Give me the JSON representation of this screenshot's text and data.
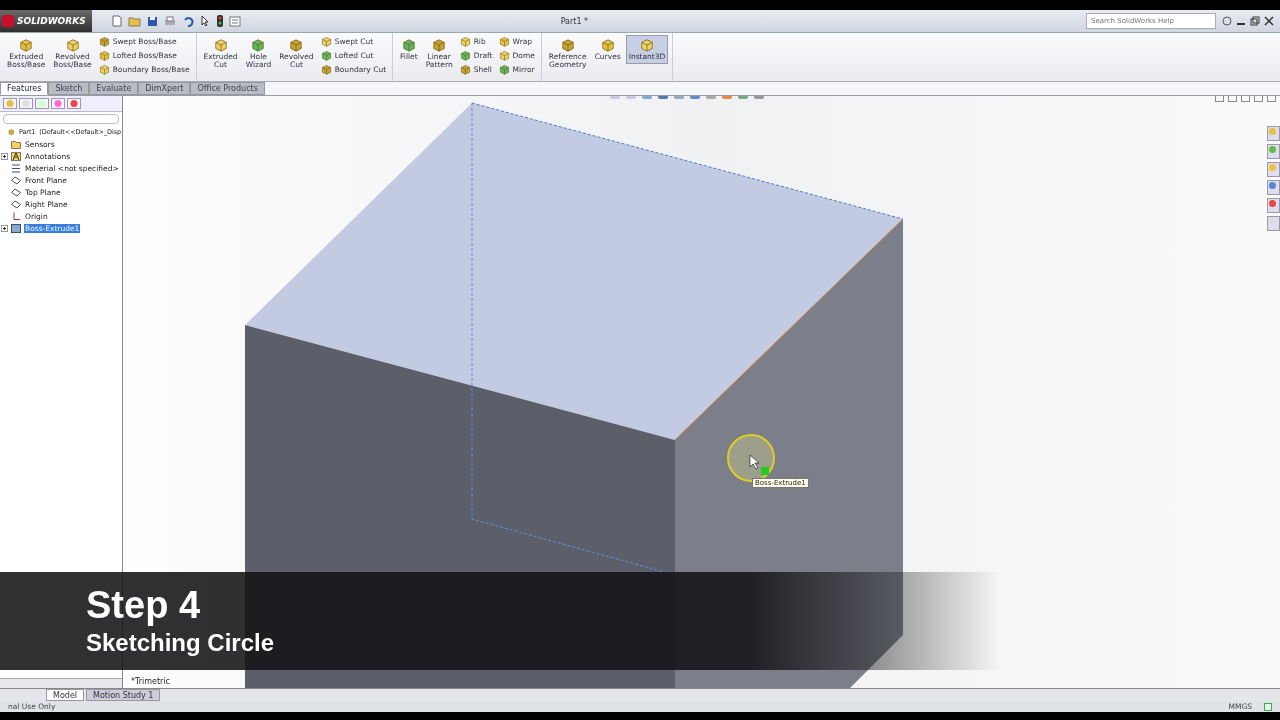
{
  "app": {
    "logo": "SOLIDWORKS",
    "document_title": "Part1 *",
    "search": {
      "placeholder": "Search SolidWorks Help"
    }
  },
  "ribbon": {
    "groups": [
      {
        "items": [
          {
            "label": "Extruded\nBoss/Base",
            "kind": "large"
          },
          {
            "label": "Revolved\nBoss/Base",
            "kind": "large"
          },
          {
            "label": "Swept Boss/Base",
            "kind": "small"
          },
          {
            "label": "Lofted Boss/Base",
            "kind": "small"
          },
          {
            "label": "Boundary Boss/Base",
            "kind": "small"
          }
        ]
      },
      {
        "items": [
          {
            "label": "Extruded\nCut",
            "kind": "large"
          },
          {
            "label": "Hole\nWizard",
            "kind": "large"
          },
          {
            "label": "Revolved\nCut",
            "kind": "large"
          },
          {
            "label": "Swept Cut",
            "kind": "small"
          },
          {
            "label": "Lofted Cut",
            "kind": "small"
          },
          {
            "label": "Boundary Cut",
            "kind": "small"
          }
        ]
      },
      {
        "items": [
          {
            "label": "Fillet",
            "kind": "large"
          },
          {
            "label": "Linear\nPattern",
            "kind": "large"
          },
          {
            "label": "Rib",
            "kind": "small"
          },
          {
            "label": "Draft",
            "kind": "small"
          },
          {
            "label": "Shell",
            "kind": "small"
          },
          {
            "label": "Wrap",
            "kind": "small"
          },
          {
            "label": "Dome",
            "kind": "small"
          },
          {
            "label": "Mirror",
            "kind": "small"
          }
        ]
      },
      {
        "items": [
          {
            "label": "Reference\nGeometry",
            "kind": "large"
          },
          {
            "label": "Curves",
            "kind": "large"
          },
          {
            "label": "Instant3D",
            "kind": "toggle",
            "on": true
          }
        ]
      }
    ]
  },
  "command_tabs": [
    {
      "label": "Features",
      "selected": true
    },
    {
      "label": "Sketch",
      "selected": false
    },
    {
      "label": "Evaluate",
      "selected": false
    },
    {
      "label": "DimXpert",
      "selected": false
    },
    {
      "label": "Office Products",
      "selected": false
    }
  ],
  "feature_tree": {
    "root": "Part1  (Default<<Default>_Disp",
    "items": [
      {
        "label": "Sensors",
        "kind": "folder",
        "expandable": false,
        "selected": false
      },
      {
        "label": "Annotations",
        "kind": "annotation",
        "expandable": true,
        "selected": false
      },
      {
        "label": "Material <not specified>",
        "kind": "material",
        "expandable": false,
        "selected": false
      },
      {
        "label": "Front Plane",
        "kind": "plane",
        "expandable": false,
        "selected": false
      },
      {
        "label": "Top Plane",
        "kind": "plane",
        "expandable": false,
        "selected": false
      },
      {
        "label": "Right Plane",
        "kind": "plane",
        "expandable": false,
        "selected": false
      },
      {
        "label": "Origin",
        "kind": "origin",
        "expandable": false,
        "selected": false
      },
      {
        "label": "Boss-Extrude1",
        "kind": "feature",
        "expandable": true,
        "selected": true
      }
    ]
  },
  "viewport": {
    "view_label": "*Trimetric",
    "tooltip": "Boss-Extrude1"
  },
  "caption": {
    "title": "Step 4",
    "subtitle": "Sketching Circle"
  },
  "bottom_tabs": [
    {
      "label": "Model",
      "selected": true
    },
    {
      "label": "Motion Study 1",
      "selected": false
    }
  ],
  "status_bar": {
    "text": "nal Use Only",
    "units": "MMGS"
  }
}
